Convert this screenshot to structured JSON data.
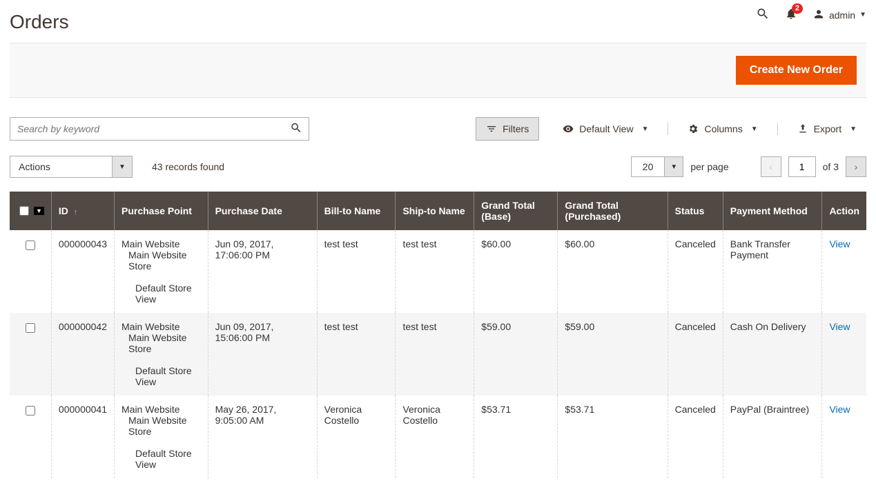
{
  "header": {
    "title": "Orders",
    "notif_count": "2",
    "admin_user": "admin"
  },
  "action_bar": {
    "create_order": "Create New Order"
  },
  "toolbar": {
    "search_placeholder": "Search by keyword",
    "filters": "Filters",
    "default_view": "Default View",
    "columns": "Columns",
    "export": "Export"
  },
  "list_controls": {
    "actions_label": "Actions",
    "records_found": "43 records found",
    "per_page_value": "20",
    "per_page_label": "per page",
    "page_current": "1",
    "page_total_label": "of 3"
  },
  "columns": {
    "id": "ID",
    "purchase_point": "Purchase Point",
    "purchase_date": "Purchase Date",
    "bill_to": "Bill-to Name",
    "ship_to": "Ship-to Name",
    "grand_total_base": "Grand Total (Base)",
    "grand_total_purchased": "Grand Total (Purchased)",
    "status": "Status",
    "payment_method": "Payment Method",
    "action": "Action"
  },
  "purchase_point_lines": {
    "l1": "Main Website",
    "l2": "Main Website Store",
    "l3": "Default Store View"
  },
  "rows": [
    {
      "id": "000000043",
      "date": "Jun 09, 2017, 17:06:00 PM",
      "bill_to": "test test",
      "ship_to": "test test",
      "gt_base": "$60.00",
      "gt_purchased": "$60.00",
      "status": "Canceled",
      "payment": "Bank Transfer Payment",
      "action": "View"
    },
    {
      "id": "000000042",
      "date": "Jun 09, 2017, 15:06:00 PM",
      "bill_to": "test test",
      "ship_to": "test test",
      "gt_base": "$59.00",
      "gt_purchased": "$59.00",
      "status": "Canceled",
      "payment": "Cash On Delivery",
      "action": "View"
    },
    {
      "id": "000000041",
      "date": "May 26, 2017, 9:05:00 AM",
      "bill_to": "Veronica Costello",
      "ship_to": "Veronica Costello",
      "gt_base": "$53.71",
      "gt_purchased": "$53.71",
      "status": "Canceled",
      "payment": "PayPal (Braintree)",
      "action": "View"
    }
  ]
}
